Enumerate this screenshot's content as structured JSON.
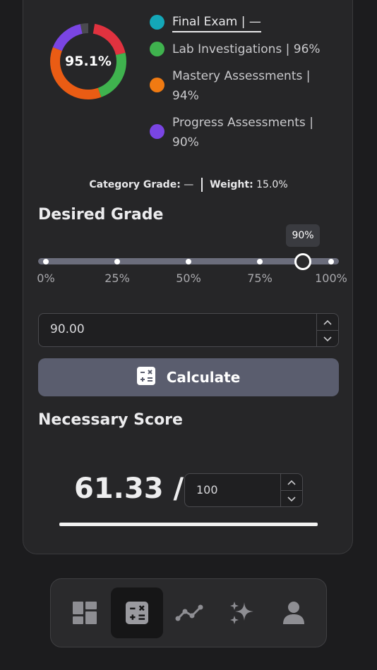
{
  "summary": {
    "overall_grade": "95.1%",
    "legend": [
      {
        "label": "Final Exam | —",
        "color": "#14a7b8"
      },
      {
        "label": "Lab Investigations | 96%",
        "color": "#3fb24e"
      },
      {
        "label": "Mastery Assessments | 94%",
        "color": "#f07a12"
      },
      {
        "label": "Progress Assessments | 90%",
        "color": "#7a45e3"
      }
    ],
    "donut_colors": {
      "red": "#e0323f",
      "green": "#3fb24e",
      "orange": "#ea5c14",
      "purple": "#7a45e3",
      "gray": "#4a4a50"
    },
    "category_grade_label": "Category Grade:",
    "category_grade_value": "—",
    "weight_label": "Weight:",
    "weight_value": "15.0%"
  },
  "desired_grade": {
    "title": "Desired Grade",
    "slider_value_percent": 90,
    "tooltip": "90%",
    "tick_labels": [
      "0%",
      "25%",
      "50%",
      "75%",
      "100%"
    ],
    "input_value": "90.00",
    "calculate_label": "Calculate"
  },
  "necessary_score": {
    "title": "Necessary Score",
    "score_text": "61.33 /",
    "out_of_value": "100"
  },
  "nav": {
    "items": [
      {
        "name": "dashboard-icon",
        "active": false
      },
      {
        "name": "calculator-icon",
        "active": true
      },
      {
        "name": "trend-icon",
        "active": false
      },
      {
        "name": "sparkles-icon",
        "active": false
      },
      {
        "name": "profile-icon",
        "active": false
      }
    ]
  }
}
